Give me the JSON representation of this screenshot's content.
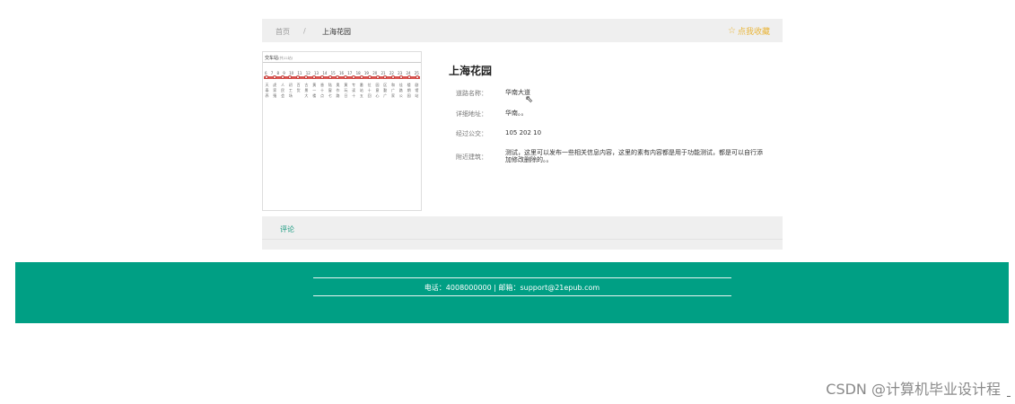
{
  "breadcrumb": {
    "home": "首页",
    "separator": "/",
    "current": "上海花园"
  },
  "favorite": {
    "icon": "star-outline-icon",
    "label": "点我收藏",
    "color": "#e9b53a"
  },
  "route_map": {
    "title": "交车站",
    "title_note": "(共22站)",
    "stops": [
      {
        "num": "6",
        "name": "天泰养"
      },
      {
        "num": "7",
        "name": "虎家殖"
      },
      {
        "num": "8",
        "name": "人民会"
      },
      {
        "num": "9",
        "name": "初工场"
      },
      {
        "num": "10",
        "name": "百货"
      },
      {
        "num": "11",
        "name": "古景大"
      },
      {
        "num": "12",
        "name": "黄一楼"
      },
      {
        "num": "13",
        "name": "香十点"
      },
      {
        "num": "14",
        "name": "陆窗七"
      },
      {
        "num": "15",
        "name": "奥作路"
      },
      {
        "num": "16",
        "name": "黄玩日"
      },
      {
        "num": "17",
        "name": "专读十"
      },
      {
        "num": "18",
        "name": "番站五"
      },
      {
        "num": "19",
        "name": "位十回"
      },
      {
        "num": "20",
        "name": "园意心"
      },
      {
        "num": "21",
        "name": "区勤广"
      },
      {
        "num": "22",
        "name": "和广家"
      },
      {
        "num": "23",
        "name": "佳路公"
      },
      {
        "num": "24",
        "name": "楼期园"
      },
      {
        "num": "25",
        "name": "剧馆站"
      }
    ]
  },
  "detail": {
    "title": "上海花园",
    "fields": [
      {
        "label": "道路名称：",
        "value": "华南大道"
      },
      {
        "label": "详细地址：",
        "value": "华南。。"
      },
      {
        "label": "经过公交：",
        "value": "105 202 10"
      },
      {
        "label": "附近建筑：",
        "value": "测试，这里可以发布一些相关信息内容，这里的素有内容都是用于功能测试，都是可以自行添加修改删除的。。"
      }
    ]
  },
  "comments": {
    "tab_label": "评论"
  },
  "footer": {
    "contact": "电话：4008000000 | 邮箱：support@21epub.com",
    "background": "#009f84"
  },
  "watermark": "CSDN @计算机毕业设计程"
}
